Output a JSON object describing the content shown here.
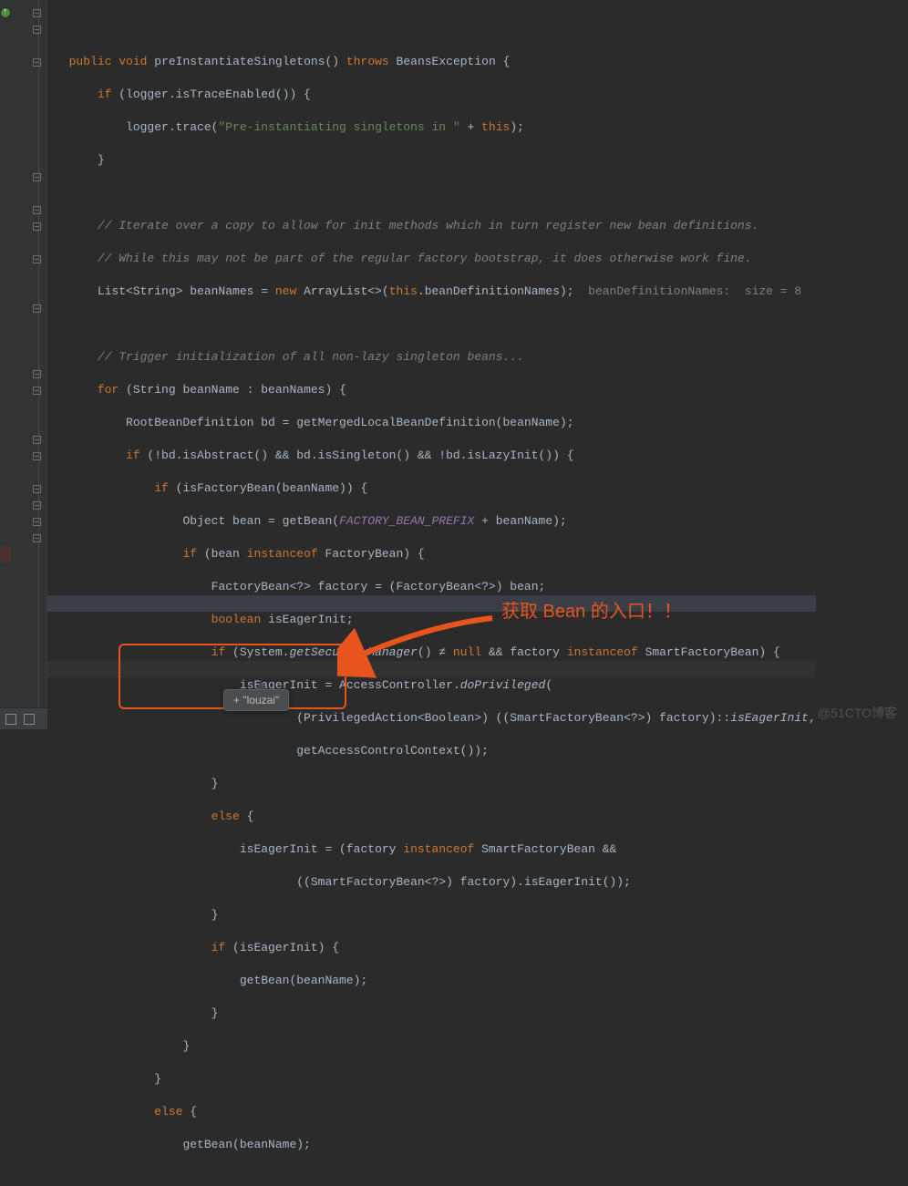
{
  "code": {
    "method_signature": {
      "p1": "public",
      "p2": "void",
      "name": "preInstantiateSingletons()",
      "throws": "throws",
      "exc": "BeansException {"
    },
    "l1": {
      "a": "if ",
      "b": "(logger.isTraceEnabled()) {"
    },
    "l2": {
      "a": "logger.trace(",
      "s": "\"Pre-instantiating singletons in \"",
      "b": " + ",
      "c": "this",
      "d": ");"
    },
    "l3": "}",
    "c1": "// Iterate over a copy to allow for init methods which in turn register new bean definitions.",
    "c2": "// While this may not be part of the regular factory bootstrap, it does otherwise work fine.",
    "l4": {
      "a": "List<String> beanNames = ",
      "n": "new",
      "b": " ArrayList<>(",
      "t": "this",
      "c": ".beanDefinitionNames);",
      "com": "  beanDefinitionNames:  size = 8"
    },
    "c3": "// Trigger initialization of all non-lazy singleton beans...",
    "l5": {
      "a": "for ",
      "b": "(String beanName : beanNames) {"
    },
    "l6": "RootBeanDefinition bd = getMergedLocalBeanDefinition(beanName);",
    "l7": {
      "a": "if ",
      "b": "(!bd.isAbstract() && bd.isSingleton() && !bd.isLazyInit()) {"
    },
    "l8": {
      "a": "if ",
      "b": "(isFactoryBean(beanName)) {"
    },
    "l9": {
      "a": "Object bean = getBean(",
      "c": "FACTORY_BEAN_PREFIX",
      "b": " + beanName);"
    },
    "l10": {
      "a": "if ",
      "b": "(bean ",
      "i": "instanceof",
      "c": " FactoryBean) {"
    },
    "l11": "FactoryBean<?> factory = (FactoryBean<?>) bean;",
    "l12": {
      "a": "boolean ",
      "b": "isEagerInit;"
    },
    "l13": {
      "a": "if ",
      "b": "(System.",
      "m": "getSecurityManager",
      "c": "() ≠ ",
      "n": "null",
      "d": " && factory ",
      "i": "instanceof",
      "e": " SmartFactoryBean) {"
    },
    "l14": {
      "a": "isEagerInit = AccessController.",
      "m": "doPrivileged",
      "b": "("
    },
    "l15": {
      "a": "(PrivilegedAction<Boolean>) ((SmartFactoryBean<?>) factory)::",
      "m": "isEagerInit",
      "b": ","
    },
    "l16": "getAccessControlContext());",
    "l17": "}",
    "l18": {
      "a": "else ",
      "b": "{"
    },
    "l19": {
      "a": "isEagerInit = (factory ",
      "i": "instanceof",
      "b": " SmartFactoryBean &&"
    },
    "l20": "((SmartFactoryBean<?>) factory).isEagerInit());",
    "l21": "}",
    "l22": {
      "a": "if ",
      "b": "(isEagerInit) {"
    },
    "l23": "getBean(beanName);",
    "l24": "}",
    "l25": "}",
    "l26": "}",
    "l27": {
      "a": "else ",
      "b": "{"
    },
    "l28": "getBean(beanName);"
  },
  "tooltip": {
    "plus": "+",
    "text": "\"louzai\""
  },
  "annotation_text": "获取 Bean 的入口！！",
  "watermark": "@51CTO博客"
}
